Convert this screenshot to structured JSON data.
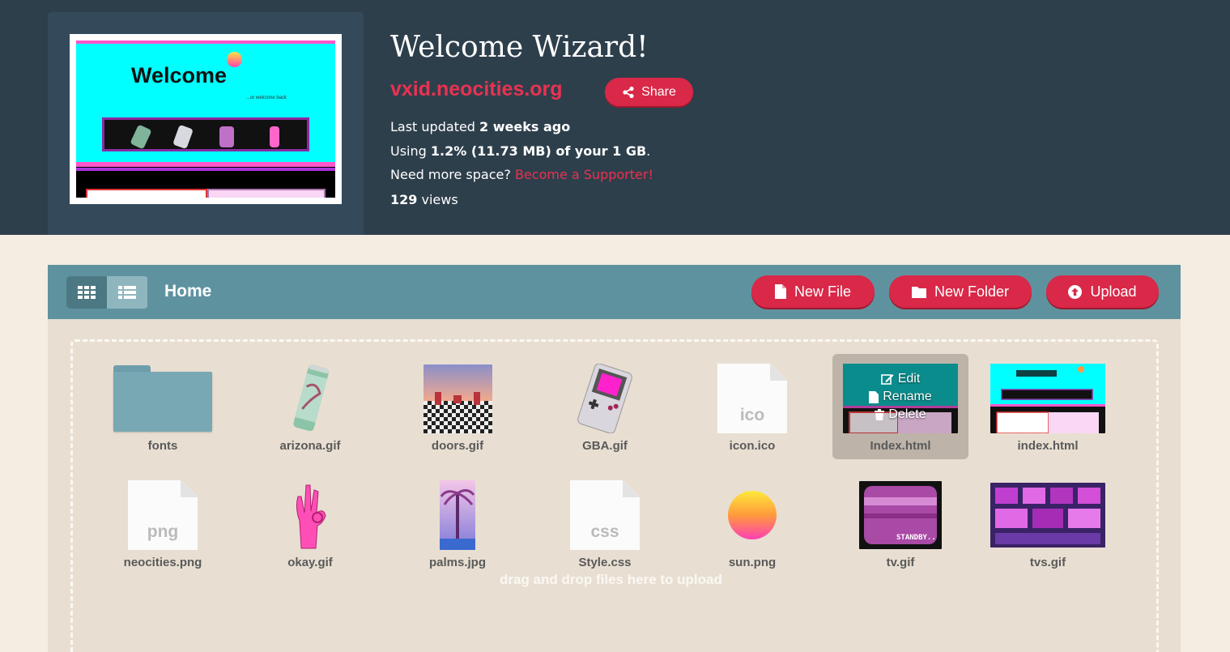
{
  "site": {
    "title": "Welcome Wizard!",
    "url": "vxid.neocities.org",
    "share_label": "Share",
    "last_updated_prefix": "Last updated",
    "last_updated_value": "2 weeks ago",
    "usage_prefix": "Using",
    "usage_value": "1.2% (11.73 MB) of your 1 GB",
    "usage_suffix": ".",
    "space_prompt": "Need more space?",
    "supporter_link": "Become a Supporter!",
    "views_count": "129",
    "views_label": "views"
  },
  "preview": {
    "heading": "Welcome",
    "subheading": "...or welcome back"
  },
  "toolbar": {
    "breadcrumb": "Home",
    "new_file": "New File",
    "new_folder": "New Folder",
    "upload": "Upload"
  },
  "dropzone": {
    "text": "drag and drop files here to upload"
  },
  "hover_actions": {
    "edit": "Edit",
    "rename": "Rename",
    "delete": "Delete"
  },
  "files": [
    {
      "name": "fonts",
      "kind": "folder"
    },
    {
      "name": "arizona.gif",
      "kind": "image"
    },
    {
      "name": "doors.gif",
      "kind": "image"
    },
    {
      "name": "GBA.gif",
      "kind": "image"
    },
    {
      "name": "icon.ico",
      "kind": "doc",
      "ext": "ico"
    },
    {
      "name": "Index.html",
      "kind": "image",
      "hovered": true
    },
    {
      "name": "index.html",
      "kind": "image"
    },
    {
      "name": "neocities.png",
      "kind": "doc",
      "ext": "png"
    },
    {
      "name": "okay.gif",
      "kind": "image"
    },
    {
      "name": "palms.jpg",
      "kind": "image"
    },
    {
      "name": "Style.css",
      "kind": "doc",
      "ext": "css"
    },
    {
      "name": "sun.png",
      "kind": "image"
    },
    {
      "name": "tv.gif",
      "kind": "image"
    },
    {
      "name": "tvs.gif",
      "kind": "image"
    }
  ],
  "colors": {
    "header_bg": "#2e3f4c",
    "accent": "#d92848",
    "toolbar_bg": "#5f929f",
    "panel_bg": "#e8dfd2",
    "page_bg": "#f5ede2"
  }
}
